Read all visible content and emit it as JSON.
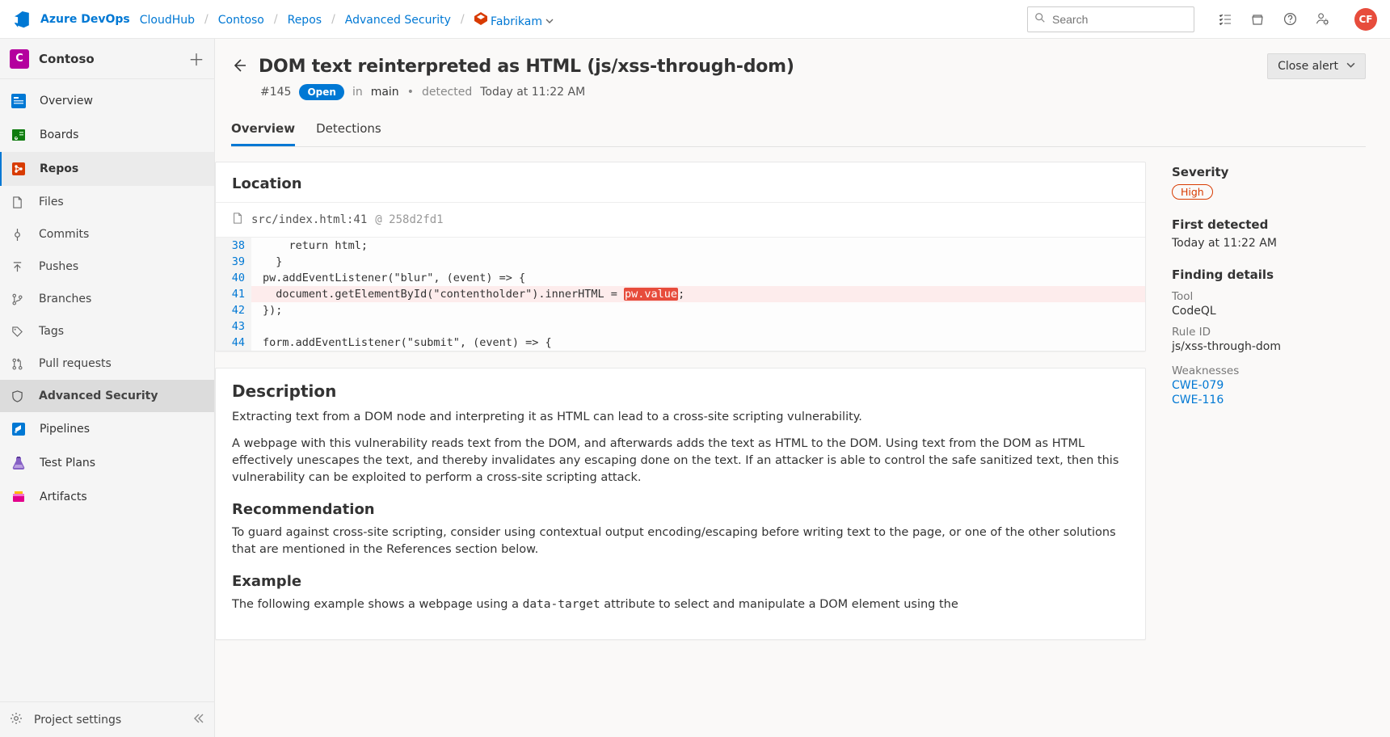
{
  "brand": "Azure DevOps",
  "breadcrumbs": {
    "org": "CloudHub",
    "project": "Contoso",
    "area": "Repos",
    "hub": "Advanced Security",
    "repo": "Fabrikam"
  },
  "search": {
    "placeholder": "Search"
  },
  "avatar": "CF",
  "sidebar": {
    "project_initial": "C",
    "project_name": "Contoso",
    "items": {
      "overview": "Overview",
      "boards": "Boards",
      "repos": "Repos",
      "pipelines": "Pipelines",
      "test_plans": "Test Plans",
      "artifacts": "Artifacts"
    },
    "repo_sub": {
      "files": "Files",
      "commits": "Commits",
      "pushes": "Pushes",
      "branches": "Branches",
      "tags": "Tags",
      "pull_requests": "Pull requests",
      "advanced_security": "Advanced Security"
    },
    "footer": "Project settings"
  },
  "header": {
    "title": "DOM text reinterpreted as HTML (js/xss-through-dom)",
    "alert_id": "#145",
    "status": "Open",
    "branch_prefix": "in",
    "branch": "main",
    "detected_label": "detected",
    "detected_time": "Today at 11:22 AM",
    "close_btn": "Close alert"
  },
  "tabs": {
    "overview": "Overview",
    "detections": "Detections"
  },
  "location": {
    "heading": "Location",
    "path": "src/index.html:41",
    "at": "@",
    "commit": "258d2fd1",
    "lines": [
      {
        "n": 38,
        "text": "    return html;"
      },
      {
        "n": 39,
        "text": "  }"
      },
      {
        "n": 40,
        "text": "pw.addEventListener(\"blur\", (event) => {"
      },
      {
        "n": 41,
        "pre": "  document.getElementById(\"contentholder\").innerHTML = ",
        "hl": "pw.value",
        "post": ";",
        "highlighted": true
      },
      {
        "n": 42,
        "text": "});"
      },
      {
        "n": 43,
        "text": ""
      },
      {
        "n": 44,
        "text": "form.addEventListener(\"submit\", (event) => {"
      }
    ]
  },
  "description": {
    "heading": "Description",
    "p1": "Extracting text from a DOM node and interpreting it as HTML can lead to a cross-site scripting vulnerability.",
    "p2": "A webpage with this vulnerability reads text from the DOM, and afterwards adds the text as HTML to the DOM. Using text from the DOM as HTML effectively unescapes the text, and thereby invalidates any escaping done on the text. If an attacker is able to control the safe sanitized text, then this vulnerability can be exploited to perform a cross-site scripting attack.",
    "rec_heading": "Recommendation",
    "rec_text": "To guard against cross-site scripting, consider using contextual output encoding/escaping before writing text to the page, or one of the other solutions that are mentioned in the References section below.",
    "example_heading": "Example",
    "example_pre": "The following example shows a webpage using a ",
    "example_code": "data-target",
    "example_post": " attribute to select and manipulate a DOM element using the"
  },
  "aside": {
    "severity_label": "Severity",
    "severity_value": "High",
    "first_detected_label": "First detected",
    "first_detected_value": "Today at 11:22 AM",
    "finding_label": "Finding details",
    "tool_label": "Tool",
    "tool_value": "CodeQL",
    "rule_label": "Rule ID",
    "rule_value": "js/xss-through-dom",
    "weak_label": "Weaknesses",
    "cwe1": "CWE-079",
    "cwe2": "CWE-116"
  }
}
